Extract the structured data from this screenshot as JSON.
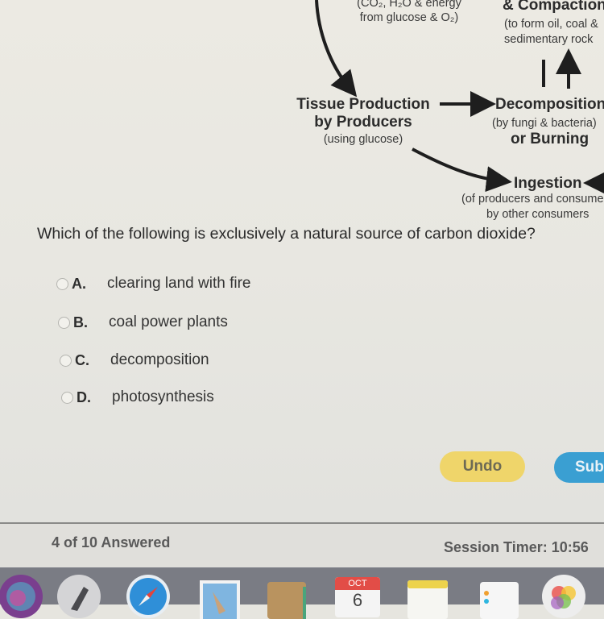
{
  "diagram": {
    "respiration_sub1": "(CO₂, H₂O & energy",
    "respiration_sub2": "from glucose & O₂)",
    "compaction_title": "& Compaction",
    "compaction_sub1": "(to form oil, coal &",
    "compaction_sub2": "sedimentary rock",
    "tissue_title1": "Tissue Production",
    "tissue_title2": "by Producers",
    "tissue_sub": "(using glucose)",
    "decomp_title": "Decomposition",
    "decomp_sub": "(by fungi & bacteria)",
    "decomp_title2": "or Burning",
    "ingestion_title": "Ingestion",
    "ingestion_sub1": "(of producers and consumers",
    "ingestion_sub2": "by other consumers"
  },
  "question": {
    "text": "Which of the following is exclusively a natural source of carbon dioxide?",
    "choices": [
      {
        "letter": "A.",
        "text": "clearing land with fire"
      },
      {
        "letter": "B.",
        "text": "coal power plants"
      },
      {
        "letter": "C.",
        "text": "decomposition"
      },
      {
        "letter": "D.",
        "text": "photosynthesis"
      }
    ]
  },
  "buttons": {
    "undo": "Undo",
    "submit": "Submit"
  },
  "footer": {
    "answered": "4 of 10 Answered",
    "timer": "Session Timer: 10:56"
  },
  "dock": {
    "icons": [
      "siri-icon",
      "launchpad-icon",
      "safari-icon",
      "mail-icon",
      "contacts-icon",
      "calendar-icon",
      "notes-icon",
      "reminders-icon",
      "photos-icon"
    ],
    "calendar_month": "OCT",
    "calendar_day": "6"
  },
  "colors": {
    "undo": "#efd56a",
    "submit": "#3a9fd2"
  }
}
